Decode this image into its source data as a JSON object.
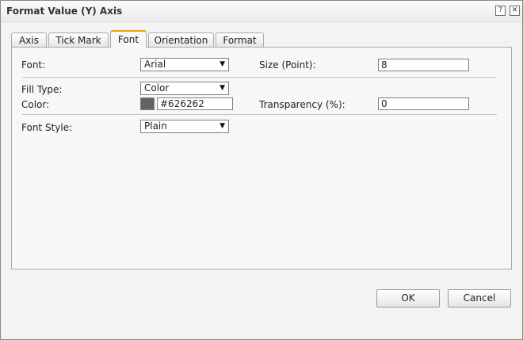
{
  "dialog": {
    "title": "Format Value (Y) Axis",
    "help_icon": "help-icon",
    "close_icon": "close-icon"
  },
  "tabs": [
    {
      "label": "Axis"
    },
    {
      "label": "Tick Mark"
    },
    {
      "label": "Font",
      "active": true
    },
    {
      "label": "Orientation"
    },
    {
      "label": "Format"
    }
  ],
  "form": {
    "font_label": "Font:",
    "font_value": "Arial",
    "size_label": "Size (Point):",
    "size_value": "8",
    "fill_type_label": "Fill Type:",
    "fill_type_value": "Color",
    "color_label": "Color:",
    "color_value": "#626262",
    "color_swatch": "#626262",
    "transparency_label": "Transparency (%):",
    "transparency_value": "0",
    "font_style_label": "Font Style:",
    "font_style_value": "Plain"
  },
  "buttons": {
    "ok": "OK",
    "cancel": "Cancel"
  },
  "colors": {
    "active_tab_accent": "#f0a01e"
  }
}
